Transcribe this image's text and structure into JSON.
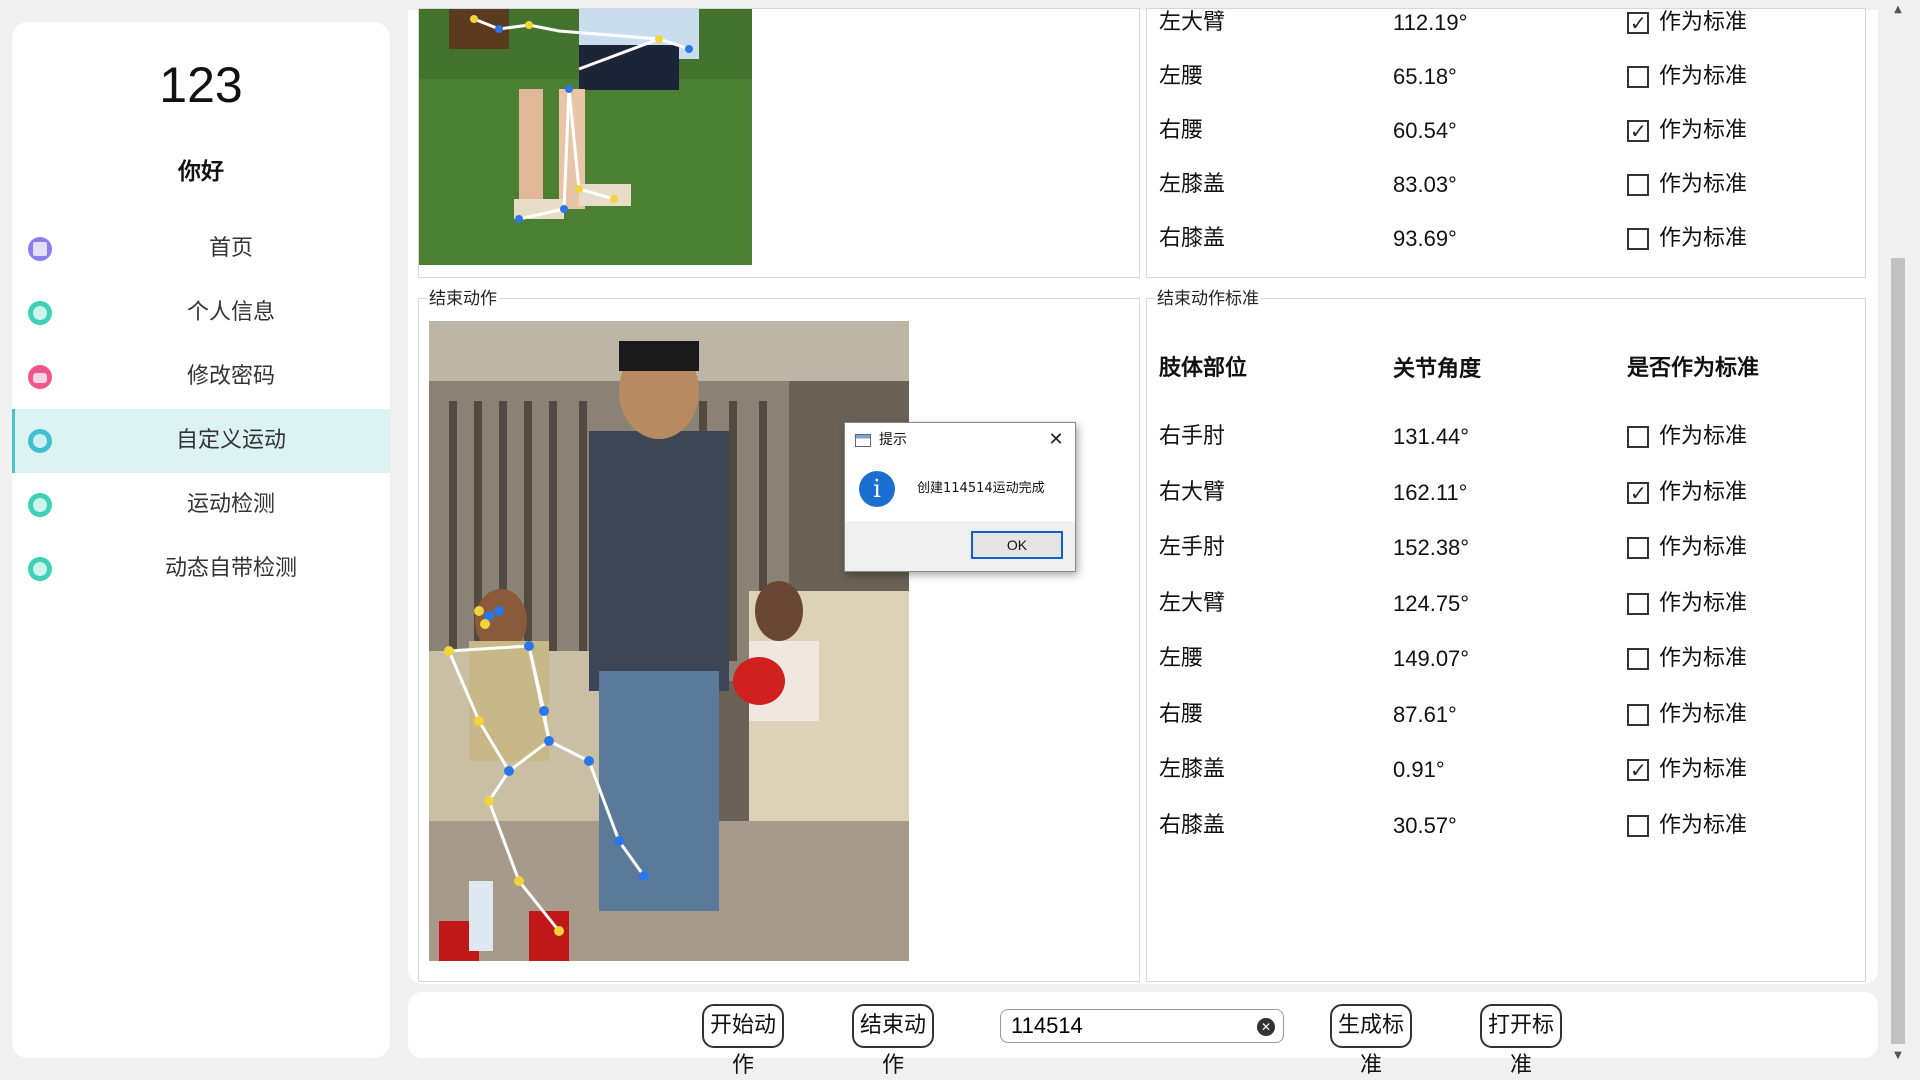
{
  "sidebar": {
    "user_number": "123",
    "greeting": "你好",
    "items": [
      {
        "label": "首页",
        "icon": "document-icon",
        "color": "#8a7ff0"
      },
      {
        "label": "个人信息",
        "icon": "person-icon",
        "color": "#3fd1b5"
      },
      {
        "label": "修改密码",
        "icon": "lock-icon",
        "color": "#f0558c"
      },
      {
        "label": "自定义运动",
        "icon": "person-icon",
        "color": "#3fbfd1",
        "active": true
      },
      {
        "label": "运动检测",
        "icon": "person-icon",
        "color": "#3fd1b5"
      },
      {
        "label": "动态自带检测",
        "icon": "person-icon",
        "color": "#3fd1b5"
      }
    ]
  },
  "start_table": {
    "rows": [
      {
        "part": "左大臂",
        "angle": "112.19°",
        "std": "作为标准",
        "checked": true
      },
      {
        "part": "左腰",
        "angle": "65.18°",
        "std": "作为标准",
        "checked": false
      },
      {
        "part": "右腰",
        "angle": "60.54°",
        "std": "作为标准",
        "checked": true
      },
      {
        "part": "左膝盖",
        "angle": "83.03°",
        "std": "作为标准",
        "checked": false
      },
      {
        "part": "右膝盖",
        "angle": "93.69°",
        "std": "作为标准",
        "checked": false
      }
    ]
  },
  "end_group": {
    "title": "结束动作"
  },
  "end_std_group": {
    "title": "结束动作标准",
    "headers": {
      "part": "肢体部位",
      "angle": "关节角度",
      "std": "是否作为标准"
    },
    "rows": [
      {
        "part": "右手肘",
        "angle": "131.44°",
        "std": "作为标准",
        "checked": false
      },
      {
        "part": "右大臂",
        "angle": "162.11°",
        "std": "作为标准",
        "checked": true
      },
      {
        "part": "左手肘",
        "angle": "152.38°",
        "std": "作为标准",
        "checked": false
      },
      {
        "part": "左大臂",
        "angle": "124.75°",
        "std": "作为标准",
        "checked": false
      },
      {
        "part": "左腰",
        "angle": "149.07°",
        "std": "作为标准",
        "checked": false
      },
      {
        "part": "右腰",
        "angle": "87.61°",
        "std": "作为标准",
        "checked": false
      },
      {
        "part": "左膝盖",
        "angle": "0.91°",
        "std": "作为标准",
        "checked": true
      },
      {
        "part": "右膝盖",
        "angle": "30.57°",
        "std": "作为标准",
        "checked": false
      }
    ]
  },
  "toolbar": {
    "start_label": "开始动作",
    "end_label": "结束动作",
    "name_value": "114514",
    "generate_label": "生成标准",
    "open_label": "打开标准"
  },
  "dialog": {
    "title": "提示",
    "message": "创建114514运动完成",
    "ok_label": "OK",
    "close_glyph": "✕",
    "info_glyph": "i"
  },
  "scrollbar": {
    "up_glyph": "▲",
    "down_glyph": "▼"
  },
  "colors": {
    "accent": "#4ec3c3",
    "active_bg": "#dcf3f3",
    "info_blue": "#1a6fd0"
  }
}
